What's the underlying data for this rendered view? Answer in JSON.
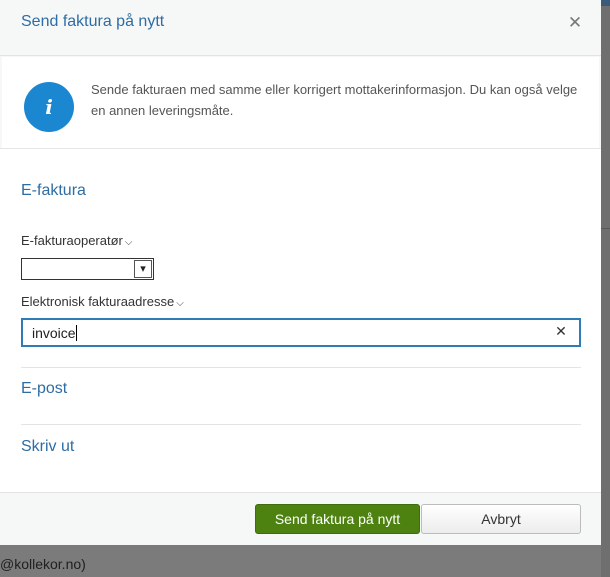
{
  "dialog": {
    "title": "Send faktura på nytt",
    "close_icon": "close-icon"
  },
  "info": {
    "icon": "info-icon",
    "icon_glyph": "i",
    "text": "Sende fakturaen med samme eller korrigert mottakerinformasjon. Du kan også velge en annen leveringsmåte."
  },
  "efaktura": {
    "section_title": "E-faktura",
    "operator_label": "E-fakturaoperatør",
    "operator_value": "",
    "address_label": "Elektronisk fakturaadresse",
    "address_value": "invoice",
    "clear_icon": "close-icon",
    "chevron_icon": "chevron-down-icon"
  },
  "epost": {
    "section_title": "E-post"
  },
  "skriv_ut": {
    "section_title": "Skriv ut"
  },
  "footer": {
    "send_label": "Send faktura på nytt",
    "cancel_label": "Avbryt"
  },
  "background": {
    "visible_text": "@kollekor.no)"
  },
  "colors": {
    "accent": "#2e6da4",
    "info_icon_bg": "#1b87d1",
    "primary_button": "#4d8210",
    "input_focus_border": "#2e7bb5"
  }
}
